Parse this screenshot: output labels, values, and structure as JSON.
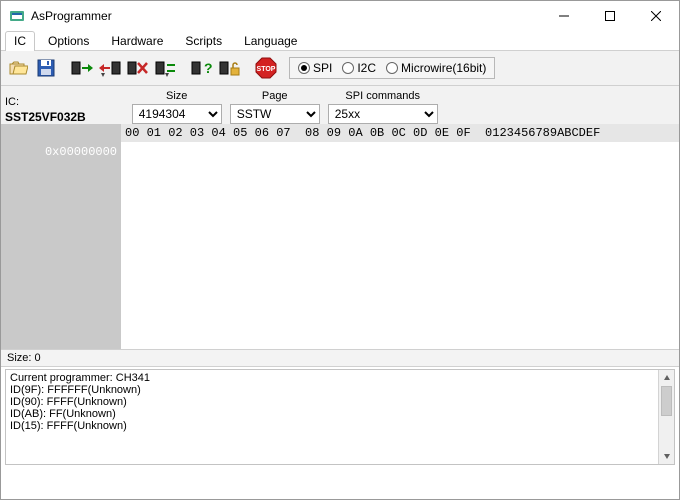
{
  "window": {
    "title": "AsProgrammer"
  },
  "menubar": {
    "items": [
      {
        "label": "IC",
        "active": true
      },
      {
        "label": "Options",
        "active": false
      },
      {
        "label": "Hardware",
        "active": false
      },
      {
        "label": "Scripts",
        "active": false
      },
      {
        "label": "Language",
        "active": false
      }
    ]
  },
  "toolbar": {
    "icons": [
      "open-file-icon",
      "save-file-icon",
      "read-ic-icon",
      "write-ic-icon",
      "erase-ic-icon",
      "verify-ic-icon",
      "detect-icon",
      "unlock-icon",
      "stop-icon"
    ]
  },
  "iface": {
    "options": [
      {
        "label": "SPI",
        "checked": true
      },
      {
        "label": "I2C",
        "checked": false
      },
      {
        "label": "Microwire(16bit)",
        "checked": false
      }
    ]
  },
  "config": {
    "ic_label": "IC:",
    "ic_value": "SST25VF032B",
    "size_label": "Size",
    "size_value": "4194304",
    "page_label": "Page",
    "page_value": "SSTW",
    "spicmd_label": "SPI commands",
    "spicmd_value": "25xx"
  },
  "hex": {
    "header": "00 01 02 03 04 05 06 07  08 09 0A 0B 0C 0D 0E 0F  0123456789ABCDEF",
    "addresses": [
      "0x00000000"
    ]
  },
  "status": {
    "size_label": "Size: 0"
  },
  "log": {
    "lines": [
      "Current programmer: CH341",
      "ID(9F): FFFFFF(Unknown)",
      "ID(90): FFFF(Unknown)",
      "ID(AB): FF(Unknown)",
      "ID(15): FFFF(Unknown)"
    ]
  }
}
